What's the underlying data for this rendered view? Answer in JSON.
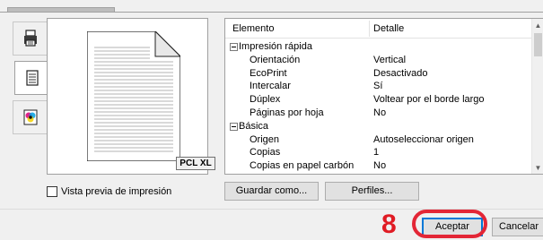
{
  "side_tabs": [
    {
      "icon": "printer-icon",
      "active": false
    },
    {
      "icon": "document-icon",
      "active": true
    },
    {
      "icon": "color-icon",
      "active": false
    }
  ],
  "preview": {
    "badge": "PCL XL"
  },
  "details": {
    "col_element": "Elemento",
    "col_detail": "Detalle",
    "rows": [
      {
        "type": "group",
        "label": "Impresión rápida",
        "value": ""
      },
      {
        "type": "item",
        "label": "Orientación",
        "value": "Vertical"
      },
      {
        "type": "item",
        "label": "EcoPrint",
        "value": "Desactivado"
      },
      {
        "type": "item",
        "label": "Intercalar",
        "value": "Sí"
      },
      {
        "type": "item",
        "label": "Dúplex",
        "value": "Voltear por el borde largo"
      },
      {
        "type": "item",
        "label": "Páginas por hoja",
        "value": "No"
      },
      {
        "type": "group",
        "label": "Básica",
        "value": ""
      },
      {
        "type": "item",
        "label": "Origen",
        "value": "Autoseleccionar origen"
      },
      {
        "type": "item",
        "label": "Copias",
        "value": "1"
      },
      {
        "type": "item",
        "label": "Copias en papel carbón",
        "value": "No"
      }
    ]
  },
  "preview_checkbox_label": "Vista previa de impresión",
  "buttons": {
    "save_as": "Guardar como...",
    "profiles": "Perfiles...",
    "accept": "Aceptar",
    "cancel": "Cancelar"
  },
  "step_number": "8",
  "colors": {
    "highlight": "#e32636",
    "step": "#e01b24",
    "accent": "#0078d7"
  }
}
